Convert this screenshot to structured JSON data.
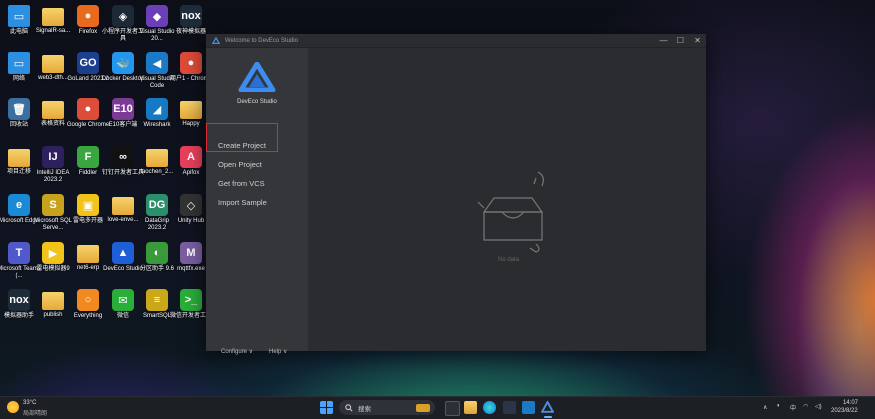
{
  "desktop": {
    "icons": [
      {
        "label": "此电脑",
        "color": "#2c8fe0",
        "kind": "pc"
      },
      {
        "label": "SignalR-sa...",
        "color": "#f0c040",
        "kind": "folder"
      },
      {
        "label": "Firefox",
        "color": "#e86a1e",
        "kind": "app",
        "glyph": "●"
      },
      {
        "label": "小程序开发者工具",
        "color": "#1c2a38",
        "kind": "app",
        "glyph": "◈"
      },
      {
        "label": "Visual Studio 20...",
        "color": "#6c3fb8",
        "kind": "app",
        "glyph": "◆"
      },
      {
        "label": "夜神模拟器",
        "color": "#1e2c3a",
        "kind": "app",
        "glyph": "nox"
      },
      {
        "label": "网络",
        "color": "#2c8fe0",
        "kind": "pc"
      },
      {
        "label": "web3-dth...",
        "color": "#f0c040",
        "kind": "folder"
      },
      {
        "label": "GoLand 2023.2",
        "color": "#1d3f8f",
        "kind": "app",
        "glyph": "GO"
      },
      {
        "label": "Docker Desktop",
        "color": "#2496ed",
        "kind": "app",
        "glyph": "🐳"
      },
      {
        "label": "Visual Studio Code",
        "color": "#1a7ac8",
        "kind": "app",
        "glyph": "◀"
      },
      {
        "label": "用户1 - Chrome",
        "color": "#dd4b39",
        "kind": "app",
        "glyph": "●"
      },
      {
        "label": "回收站",
        "color": "#3a6fa0",
        "kind": "app",
        "glyph": "🗑"
      },
      {
        "label": "表格资料",
        "color": "#f0c040",
        "kind": "folder"
      },
      {
        "label": "Google Chrome",
        "color": "#dd4b39",
        "kind": "app",
        "glyph": "●"
      },
      {
        "label": "E10客户端",
        "color": "#7b3b94",
        "kind": "app",
        "glyph": "E10"
      },
      {
        "label": "Wireshark",
        "color": "#1679c4",
        "kind": "app",
        "glyph": "◢"
      },
      {
        "label": "Happy",
        "color": "#f0c040",
        "kind": "folder"
      },
      {
        "label": "项目迁移",
        "color": "#f0c040",
        "kind": "folder"
      },
      {
        "label": "IntelliJ IDEA 2023.2",
        "color": "#2e1f5e",
        "kind": "app",
        "glyph": "IJ"
      },
      {
        "label": "Fiddler",
        "color": "#3aa640",
        "kind": "app",
        "glyph": "F"
      },
      {
        "label": "钉钉开发者工具",
        "color": "#111",
        "kind": "app",
        "glyph": "∞"
      },
      {
        "label": "laochen_2...",
        "color": "#f0c040",
        "kind": "folder"
      },
      {
        "label": "Apifox",
        "color": "#e8405a",
        "kind": "app",
        "glyph": "A"
      },
      {
        "label": "Microsoft Edge",
        "color": "#1a8ad4",
        "kind": "app",
        "glyph": "e"
      },
      {
        "label": "Microsoft SQL Serve...",
        "color": "#c7a21c",
        "kind": "app",
        "glyph": "S"
      },
      {
        "label": "雷电多开器",
        "color": "#f2c318",
        "kind": "app",
        "glyph": "▣"
      },
      {
        "label": "love-enve...",
        "color": "#f0c040",
        "kind": "folder"
      },
      {
        "label": "DataGrip 2023.2",
        "color": "#2a8f6a",
        "kind": "app",
        "glyph": "DG"
      },
      {
        "label": "Unity Hub",
        "color": "#333",
        "kind": "app",
        "glyph": "◇"
      },
      {
        "label": "Microsoft Teams (...",
        "color": "#5059c9",
        "kind": "app",
        "glyph": "T"
      },
      {
        "label": "雷电模拟器9",
        "color": "#f2c318",
        "kind": "app",
        "glyph": "▶"
      },
      {
        "label": "net6-erp",
        "color": "#f0c040",
        "kind": "folder"
      },
      {
        "label": "DevEco Studio",
        "color": "#1e5fd8",
        "kind": "app",
        "glyph": "▲"
      },
      {
        "label": "分区助手 9.6",
        "color": "#3a9a3a",
        "kind": "app",
        "glyph": "◐"
      },
      {
        "label": "mqttfx.exe",
        "color": "#7a5fa0",
        "kind": "app",
        "glyph": "M"
      },
      {
        "label": "模拟器助手",
        "color": "#1e2c3a",
        "kind": "app",
        "glyph": "nox"
      },
      {
        "label": "publish",
        "color": "#f0c040",
        "kind": "folder"
      },
      {
        "label": "Everything",
        "color": "#f08a20",
        "kind": "app",
        "glyph": "○"
      },
      {
        "label": "微信",
        "color": "#2aae3a",
        "kind": "app",
        "glyph": "✉"
      },
      {
        "label": "SmartSQL",
        "color": "#caa81a",
        "kind": "app",
        "glyph": "≡"
      },
      {
        "label": "微信开发者工具",
        "color": "#2aae3a",
        "kind": "app",
        "glyph": ">_"
      }
    ]
  },
  "window": {
    "title": "Welcome to DevEco Studio",
    "controls": {
      "minimize": "—",
      "maximize": "☐",
      "close": "✕"
    },
    "logo_name": "DevEco Studio",
    "nav": [
      "Create Project",
      "Open Project",
      "Get from VCS",
      "Import Sample"
    ],
    "footer": {
      "configure": "Configure ∨",
      "help": "Help ∨"
    },
    "empty_state": "No data"
  },
  "taskbar": {
    "weather_temp": "33°C",
    "weather_desc": "局部晴朗",
    "search_placeholder": "搜索",
    "tray_ime": "中",
    "tray_chevron": "∧",
    "time": "14:07",
    "date": "2023/8/22"
  }
}
